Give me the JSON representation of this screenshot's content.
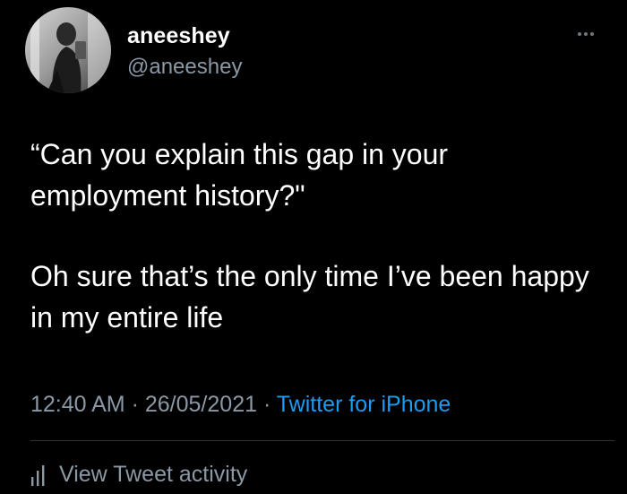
{
  "tweet": {
    "display_name": "aneeshey",
    "handle": "@aneeshey",
    "avatar_icon": "profile-photo-icon",
    "more_icon": "more-options-icon",
    "paragraphs": [
      "“Can you explain this gap in your employment history?\"",
      "Oh sure that’s the only time I’ve been happy in my entire life"
    ],
    "time": "12:40 AM",
    "separator": "·",
    "date": "26/05/2021",
    "source": "Twitter for iPhone",
    "activity_icon": "bar-chart-icon",
    "activity_label": "View Tweet activity"
  },
  "colors": {
    "background": "#000000",
    "text_primary": "#ffffff",
    "text_secondary": "#8b98a5",
    "link": "#1d9bf0",
    "divider": "#2f3336"
  }
}
